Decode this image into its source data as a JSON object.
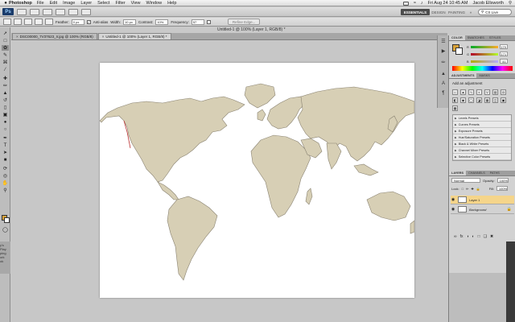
{
  "menubar": {
    "apple": "",
    "app": "Photoshop",
    "items": [
      "File",
      "Edit",
      "Image",
      "Layer",
      "Select",
      "Filter",
      "View",
      "Window",
      "Help"
    ],
    "datetime": "Fri Aug 24  10:45 AM",
    "user": "Jacob Ellsworth"
  },
  "appbar": {
    "logo": "Ps",
    "workspaces": [
      "ESSENTIALS",
      "DESIGN",
      "PAINTING",
      "»"
    ],
    "search": "CS Live"
  },
  "options": {
    "feather_label": "Feather:",
    "feather_value": "0 px",
    "antialias_label": "Anti-alias",
    "width_label": "Width:",
    "width_value": "10 px",
    "contrast_label": "Contrast:",
    "contrast_value": "10%",
    "frequency_label": "Frequency:",
    "frequency_value": "57",
    "refine_label": "Refine Edge..."
  },
  "document": {
    "window_title": "Untitled-1 @ 100% (Layer 1, RGB/8) *",
    "tabs": [
      {
        "label": "DSC00000_7V37623_Ir.jpg @ 100% (RGB/8)"
      },
      {
        "label": "Untitled-1 @ 100% (Layer 1, RGB/8) *"
      }
    ]
  },
  "colors": {
    "foreground": "#d9a23a",
    "background": "#ffffff",
    "map_fill": "#d7cfb5",
    "r": "179",
    "g": "171",
    "b": "41"
  },
  "panels": {
    "color_tabs": [
      "COLOR",
      "SWATCHES",
      "STYLES"
    ],
    "adjust_tabs": [
      "ADJUSTMENTS",
      "MASKS"
    ],
    "adjust_title": "Add an adjustment",
    "presets": [
      "Levels Presets",
      "Curves Presets",
      "Exposure Presets",
      "Hue/Saturation Presets",
      "Black & White Presets",
      "Channel Mixer Presets",
      "Selective Color Presets"
    ],
    "layers_tabs": [
      "LAYERS",
      "CHANNELS",
      "PATHS"
    ],
    "blend_mode": "Normal",
    "opacity_label": "Opacity:",
    "opacity_value": "100%",
    "lock_label": "Lock:",
    "fill_label": "Fill:",
    "fill_value": "100%",
    "layers": [
      {
        "name": "Layer 1",
        "selected": true
      },
      {
        "name": "Background",
        "selected": false
      }
    ]
  },
  "leftstrip": {
    "lines": [
      "y's Play",
      "ping",
      "",
      "ork",
      "ok"
    ]
  }
}
